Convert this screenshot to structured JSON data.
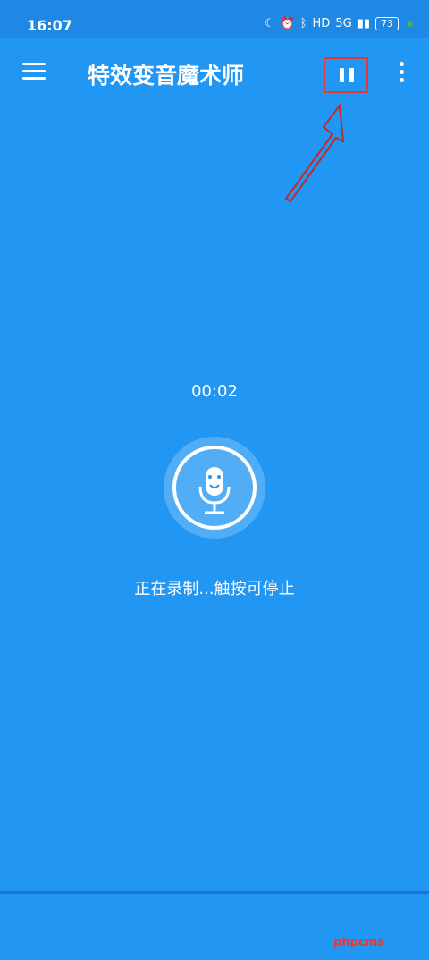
{
  "status_bar": {
    "time": "16:07",
    "hd_label": "HD",
    "network_label": "5G",
    "battery_level": "73"
  },
  "toolbar": {
    "title": "特效变音魔术师"
  },
  "recording": {
    "timer": "00:02",
    "hint": "正在录制...触按可停止"
  },
  "watermark": "phpcms",
  "colors": {
    "background": "#2196F3",
    "highlight_box": "#E53935"
  },
  "icons": {
    "menu": "hamburger-icon",
    "pause": "pause-icon",
    "more": "more-vert-icon",
    "mic": "microphone-icon"
  }
}
